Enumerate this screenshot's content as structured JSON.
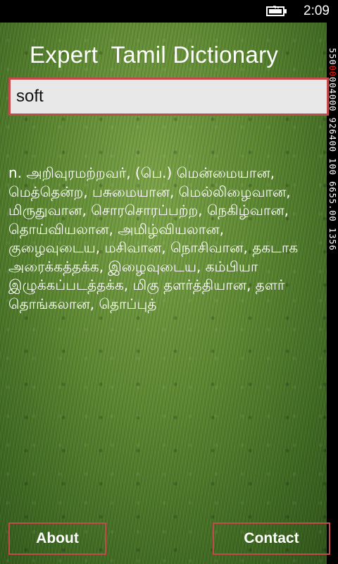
{
  "status_bar": {
    "time": "2:09",
    "battery_icon": "battery-charging-icon"
  },
  "side_strip": {
    "text_part1": "550",
    "text_red": "00",
    "text_part2": "004000 926400 100 6655.00 1356"
  },
  "app": {
    "title": "Expert  Tamil Dictionary"
  },
  "search": {
    "value": "soft",
    "placeholder": ""
  },
  "definition": {
    "text": "n. அறிவுரமற்றவர், (பெ.) மென்மையான, மெத்தென்ற, பசுமையான, மெல்லிழைவான, மிருதுவான, சொரசொரப்பற்ற, நெகிழ்வான, தொய்வியலான, அமிழ்வியலான, குழைவுடைய, மசிவான, நொசிவான, தகடாக அரைக்கத்தக்க, இழைவுடைய, கம்பியா இழுக்கப்படத்தக்க, மிகு தளர்த்தியான, தளர் தொங்கலான, தொப்புத்"
  },
  "buttons": {
    "about_label": "About",
    "contact_label": "Contact"
  },
  "colors": {
    "accent_border": "#c24a4a",
    "input_bg": "#e8e8e8",
    "grass": "#5e8a32"
  }
}
